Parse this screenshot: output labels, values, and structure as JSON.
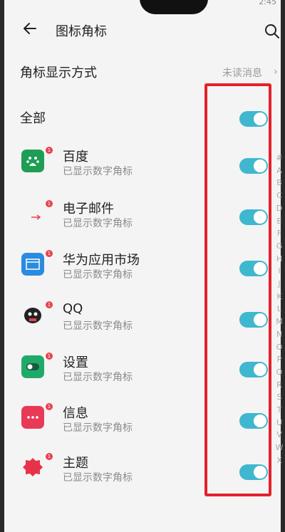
{
  "status": {
    "time": "2:45"
  },
  "header": {
    "title": "图标角标"
  },
  "badge_mode": {
    "label": "角标显示方式",
    "value": "未读消息",
    "chevron": "›"
  },
  "all_section": {
    "label": "全部",
    "enabled": true
  },
  "apps": [
    {
      "name": "百度",
      "subtitle": "已显示数字角标",
      "icon": "baidu-icon",
      "icon_color": "#1f9d55",
      "enabled": true
    },
    {
      "name": "电子邮件",
      "subtitle": "已显示数字角标",
      "icon": "email-icon",
      "icon_color": "#e8424c",
      "enabled": true
    },
    {
      "name": "华为应用市场",
      "subtitle": "已显示数字角标",
      "icon": "appgallery-icon",
      "icon_color": "#2a8be0",
      "enabled": true
    },
    {
      "name": "QQ",
      "subtitle": "已显示数字角标",
      "icon": "qq-icon",
      "icon_color": "#222222",
      "enabled": true
    },
    {
      "name": "设置",
      "subtitle": "已显示数字角标",
      "icon": "settings-icon",
      "icon_color": "#1faa6b",
      "enabled": true
    },
    {
      "name": "信息",
      "subtitle": "已显示数字角标",
      "icon": "messages-icon",
      "icon_color": "#e83a56",
      "enabled": true
    },
    {
      "name": "主题",
      "subtitle": "已显示数字角标",
      "icon": "themes-icon",
      "icon_color": "#e8324a",
      "enabled": true
    }
  ],
  "badge_count": "1",
  "index_letters": [
    "#",
    "A",
    "B",
    "C",
    "D",
    "E",
    "F",
    "G",
    "H",
    "I",
    "J",
    "K",
    "L",
    "M",
    "N",
    "O",
    "P",
    "Q",
    "R",
    "S",
    "T",
    "U",
    "V",
    "W",
    "X"
  ],
  "colors": {
    "toggle_on": "#3fb7cf",
    "highlight": "#e4212b",
    "badge": "#e8424c"
  }
}
